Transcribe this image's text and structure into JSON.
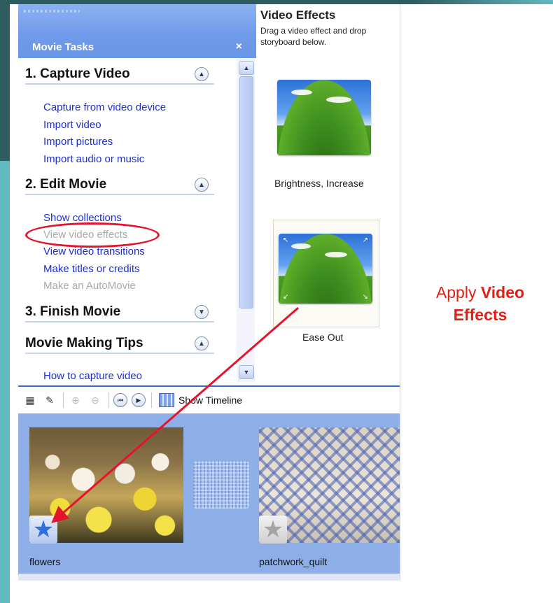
{
  "task_pane": {
    "title": "Movie Tasks",
    "close_glyph": "×",
    "sections": [
      {
        "title": "1. Capture Video",
        "toggle": "collapse",
        "links": [
          {
            "label": "Capture from video device",
            "enabled": true
          },
          {
            "label": "Import video",
            "enabled": true
          },
          {
            "label": "Import pictures",
            "enabled": true
          },
          {
            "label": "Import audio or music",
            "enabled": true
          }
        ]
      },
      {
        "title": "2. Edit Movie",
        "toggle": "collapse",
        "links": [
          {
            "label": "Show collections",
            "enabled": true
          },
          {
            "label": "View video effects",
            "enabled": false,
            "highlighted": true
          },
          {
            "label": "View video transitions",
            "enabled": true
          },
          {
            "label": "Make titles or credits",
            "enabled": true
          },
          {
            "label": "Make an AutoMovie",
            "enabled": false
          }
        ]
      },
      {
        "title": "3. Finish Movie",
        "toggle": "expand",
        "links": []
      },
      {
        "title": "Movie Making Tips",
        "toggle": "collapse",
        "links": [
          {
            "label": "How to capture video",
            "enabled": true
          }
        ]
      }
    ]
  },
  "effects_panel": {
    "title": "Video Effects",
    "description": "Drag a video effect and drop storyboard below.",
    "effects": [
      {
        "label": "Brightness, Increase",
        "selected": false
      },
      {
        "label": "Ease Out",
        "selected": true
      }
    ]
  },
  "storyboard": {
    "toolbar": {
      "show_timeline_label": "Show Timeline",
      "icons": [
        "storyboard-icon",
        "narrate-icon",
        "zoom-in-icon",
        "zoom-out-icon",
        "rewind-icon",
        "play-icon",
        "timeline-icon"
      ]
    },
    "clips": [
      {
        "label": "flowers",
        "effect_applied": true
      },
      {
        "label": "patchwork_quilt",
        "effect_applied": false
      }
    ]
  },
  "caption": {
    "prefix": "Apply",
    "bold_line1": "Video",
    "bold_line2": "Effects",
    "color": "#e31e12"
  },
  "colors": {
    "task_header": "#6f9aea",
    "link": "#1c2fd0",
    "storyboard_bg": "#8eaee8",
    "highlight_ellipse": "#e5142c"
  }
}
